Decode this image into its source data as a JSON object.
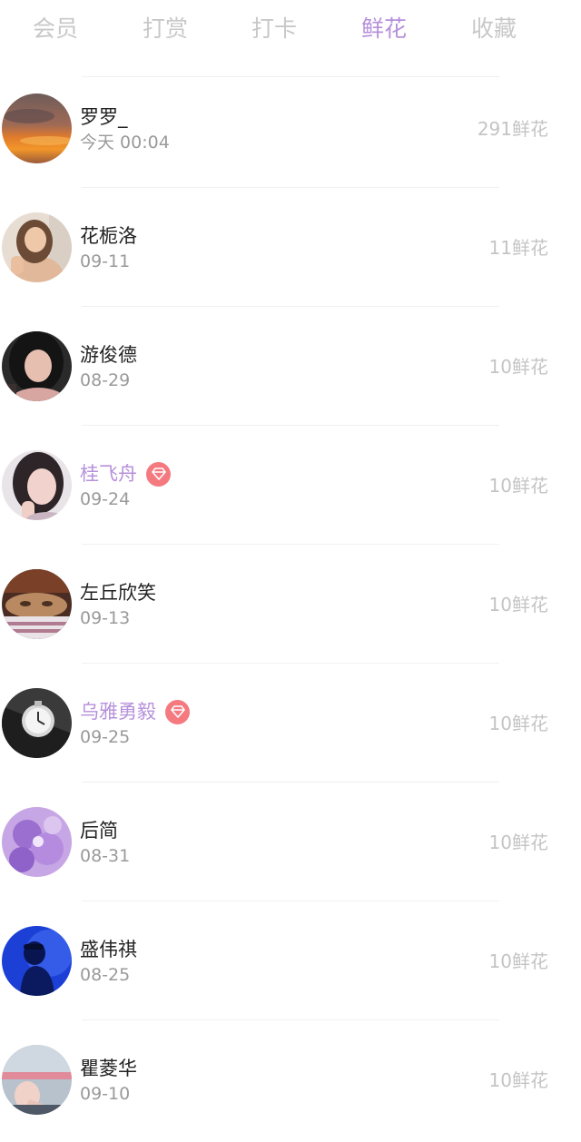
{
  "tabs": [
    {
      "label": "会员",
      "active": false
    },
    {
      "label": "打赏",
      "active": false
    },
    {
      "label": "打卡",
      "active": false
    },
    {
      "label": "鲜花",
      "active": true
    },
    {
      "label": "收藏",
      "active": false
    }
  ],
  "accent_color": "#b690db",
  "badge_color": "#f47a80",
  "vip_badge_icon": "diamond-icon",
  "list": [
    {
      "name": "罗罗_",
      "date": "今天 00:04",
      "amount": "291鲜花",
      "vip": false,
      "avatar": "sunset-photo"
    },
    {
      "name": "花栀洛",
      "date": "09-11",
      "amount": "11鲜花",
      "vip": false,
      "avatar": "woman-photo"
    },
    {
      "name": "游俊德",
      "date": "08-29",
      "amount": "10鲜花",
      "vip": false,
      "avatar": "woman-dark-hair-photo"
    },
    {
      "name": "桂飞舟",
      "date": "09-24",
      "amount": "10鲜花",
      "vip": true,
      "avatar": "girl-selfie-photo"
    },
    {
      "name": "左丘欣笑",
      "date": "09-13",
      "amount": "10鲜花",
      "vip": false,
      "avatar": "cat-photo"
    },
    {
      "name": "乌雅勇毅",
      "date": "09-25",
      "amount": "10鲜花",
      "vip": true,
      "avatar": "pocket-watch-photo"
    },
    {
      "name": "后简",
      "date": "08-31",
      "amount": "10鲜花",
      "vip": false,
      "avatar": "purple-flowers-photo"
    },
    {
      "name": "盛伟祺",
      "date": "08-25",
      "amount": "10鲜花",
      "vip": false,
      "avatar": "blue-silhouette-photo"
    },
    {
      "name": "瞿菱华",
      "date": "09-10",
      "amount": "10鲜花",
      "vip": false,
      "avatar": "sitting-person-photo"
    }
  ]
}
